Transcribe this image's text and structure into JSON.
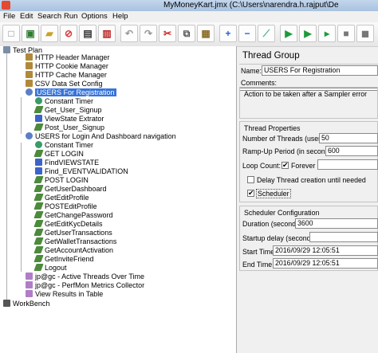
{
  "window": {
    "title": "MyMoneyKart.jmx (C:\\Users\\narendra.h.rajput\\De"
  },
  "menu": [
    "File",
    "Edit",
    "Search",
    "Run",
    "Options",
    "Help"
  ],
  "toolbar": {
    "icons": [
      "new-icon",
      "templates-icon",
      "open-icon",
      "close-icon",
      "save-icon",
      "save-as-icon",
      "undo-icon",
      "redo-icon",
      "cut-icon",
      "copy-icon",
      "paste-icon",
      "expand-icon",
      "collapse-icon",
      "toggle-icon",
      "start-icon",
      "start-no-pause-icon",
      "stop-icon"
    ]
  },
  "tree": {
    "nodes": [
      {
        "label": "Test Plan",
        "icon": "plan"
      },
      {
        "label": "HTTP Header Manager",
        "icon": "cfg"
      },
      {
        "label": "HTTP Cookie Manager",
        "icon": "cfg"
      },
      {
        "label": "HTTP Cache Manager",
        "icon": "cfg"
      },
      {
        "label": "CSV Data Set Config",
        "icon": "cfg"
      },
      {
        "label": "USERS For Registration",
        "icon": "grp",
        "selected": true
      },
      {
        "label": "Constant Timer",
        "icon": "timer"
      },
      {
        "label": "Get_User_Signup",
        "icon": "smp"
      },
      {
        "label": "ViewState Extrator",
        "icon": "pre"
      },
      {
        "label": "Post_User_Signup",
        "icon": "smp"
      },
      {
        "label": "USERS for Login And Dashboard navigation",
        "icon": "grp"
      },
      {
        "label": "Constant Timer",
        "icon": "timer"
      },
      {
        "label": "GET LOGIN",
        "icon": "smp"
      },
      {
        "label": "FindVIEWSTATE",
        "icon": "pre"
      },
      {
        "label": "Find_EVENTVALIDATION",
        "icon": "pre"
      },
      {
        "label": "POST LOGIN",
        "icon": "smp"
      },
      {
        "label": "GetUserDashboard",
        "icon": "smp"
      },
      {
        "label": "GetEditProfile",
        "icon": "smp"
      },
      {
        "label": "POSTEditProfile",
        "icon": "smp"
      },
      {
        "label": "GetChangePassword",
        "icon": "smp"
      },
      {
        "label": "GetEditKycDetails",
        "icon": "smp"
      },
      {
        "label": "GetUserTransactions",
        "icon": "smp"
      },
      {
        "label": "GetWalletTransactions",
        "icon": "smp"
      },
      {
        "label": "GetAccountActivation",
        "icon": "smp"
      },
      {
        "label": "GetInviteFriend",
        "icon": "smp"
      },
      {
        "label": "Logout",
        "icon": "smp"
      },
      {
        "label": "jp@gc - Active Threads Over Time",
        "icon": "lst"
      },
      {
        "label": "jp@gc - PerfMon Metrics Collector",
        "icon": "lst"
      },
      {
        "label": "View Results in Table",
        "icon": "lst"
      },
      {
        "label": "WorkBench",
        "icon": "bench"
      }
    ]
  },
  "panel": {
    "title": "Thread Group",
    "name_label": "Name:",
    "name_value": "USERS For Registration",
    "comments_label": "Comments:",
    "action_label": "Action to be taken after a Sampler error",
    "thread_props_label": "Thread Properties",
    "threads_label": "Number of Threads (users):",
    "threads_value": "50",
    "rampup_label": "Ramp-Up Period (in seconds):",
    "rampup_value": "600",
    "loop_label": "Loop Count:",
    "forever_label": "Forever",
    "forever_checked": true,
    "delay_label": "Delay Thread creation until needed",
    "delay_checked": false,
    "scheduler_label": "Scheduler",
    "scheduler_checked": true,
    "sched_config_label": "Scheduler Configuration",
    "duration_label": "Duration (seconds)",
    "duration_value": "3600",
    "startup_label": "Startup delay (seconds)",
    "startup_value": "",
    "start_time_label": "Start Time",
    "start_time_value": "2016/09/29 12:05:51",
    "end_time_label": "End Time",
    "end_time_value": "2016/09/29 12:05:51"
  }
}
